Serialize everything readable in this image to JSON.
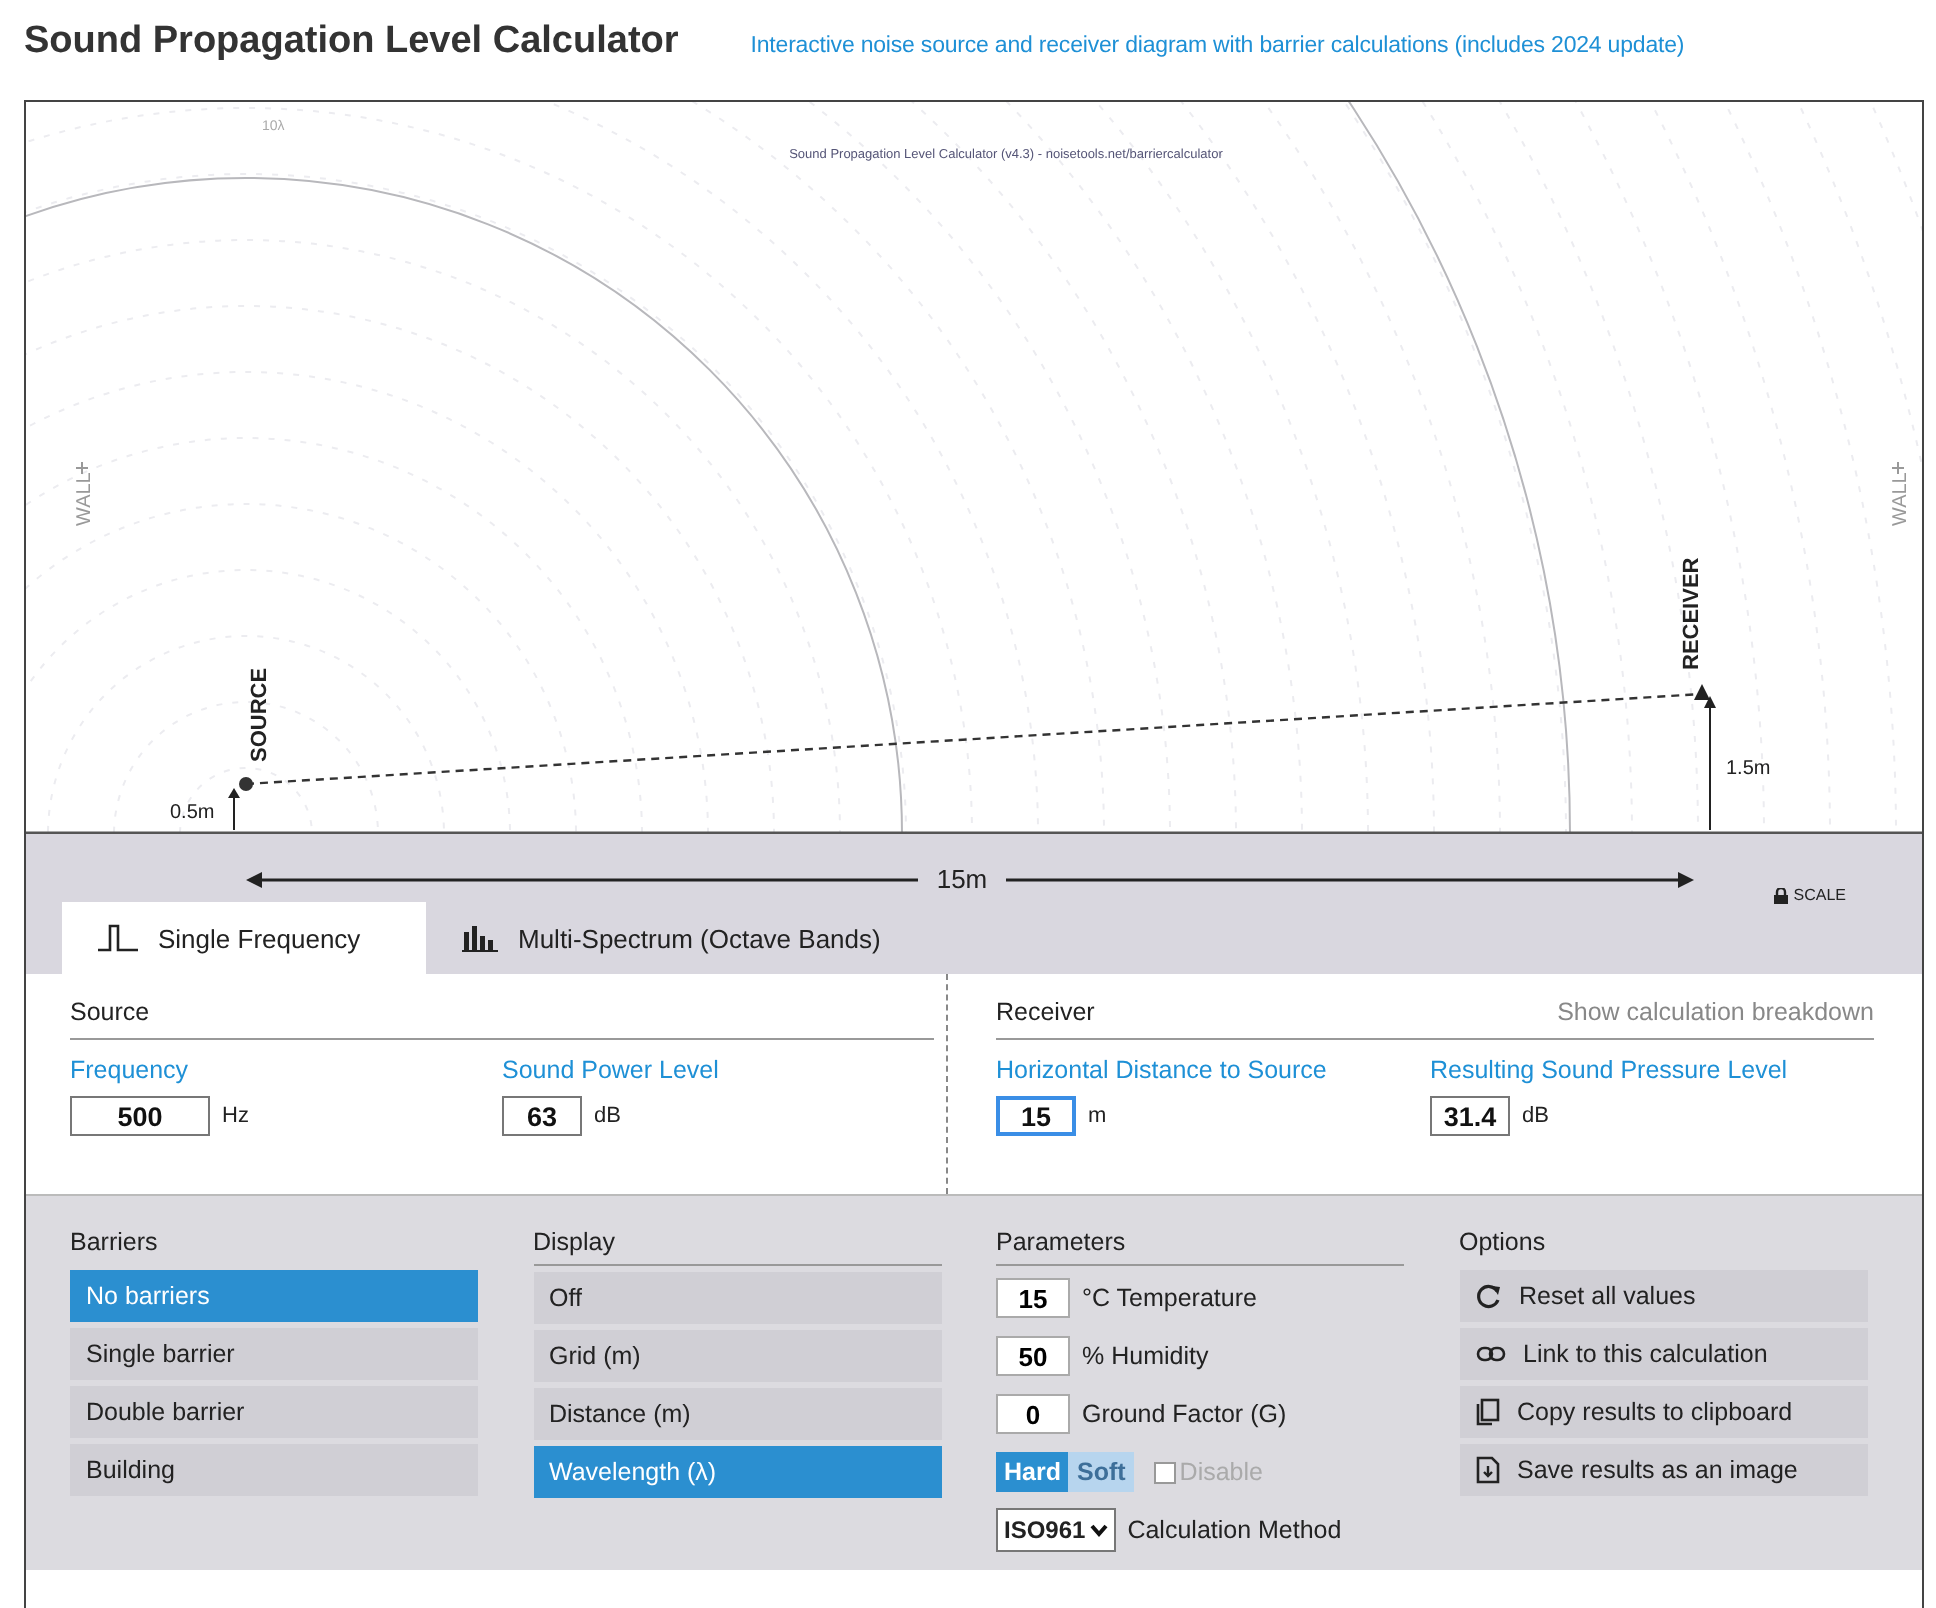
{
  "header": {
    "title": "Sound Propagation Level Calculator",
    "subtitle": "Interactive noise source and receiver diagram with barrier calculations (includes 2024 update)"
  },
  "diagram": {
    "caption": "Sound Propagation Level Calculator (v4.3) - noisetools.net/barriercalculator",
    "arc_label": "10λ",
    "wall_left": "WALL",
    "wall_right": "WALL",
    "source_label": "SOURCE",
    "source_height": "0.5m",
    "receiver_label": "RECEIVER",
    "receiver_height": "1.5m",
    "distance": "15m",
    "scale": "SCALE"
  },
  "tabs": [
    {
      "label": "Single Frequency",
      "kind": "pulse",
      "selected": true
    },
    {
      "label": "Multi-Spectrum (Octave Bands)",
      "kind": "bars",
      "selected": false
    }
  ],
  "source": {
    "heading": "Source",
    "fields": [
      {
        "label": "Frequency",
        "value": "500",
        "unit": "Hz",
        "focused": false
      },
      {
        "label": "Sound Power Level",
        "value": "63",
        "unit": "dB",
        "focused": false
      }
    ]
  },
  "receiver": {
    "heading": "Receiver",
    "breakdown_link": "Show calculation breakdown",
    "fields": [
      {
        "label": "Horizontal Distance to Source",
        "value": "15",
        "unit": "m",
        "focused": true
      },
      {
        "label": "Resulting Sound Pressure Level",
        "value": "31.4",
        "unit": "dB",
        "focused": false
      }
    ]
  },
  "barriers": {
    "heading": "Barriers",
    "items": [
      {
        "label": "No barriers",
        "selected": true
      },
      {
        "label": "Single barrier",
        "selected": false
      },
      {
        "label": "Double barrier",
        "selected": false
      },
      {
        "label": "Building",
        "selected": false
      }
    ]
  },
  "display": {
    "heading": "Display",
    "items": [
      {
        "label": "Off",
        "selected": false
      },
      {
        "label": "Grid (m)",
        "selected": false
      },
      {
        "label": "Distance (m)",
        "selected": false
      },
      {
        "label": "Wavelength (λ)",
        "selected": true
      }
    ]
  },
  "parameters": {
    "heading": "Parameters",
    "fields": [
      {
        "value": "15",
        "label": "°C Temperature"
      },
      {
        "value": "50",
        "label": "% Humidity"
      },
      {
        "value": "0",
        "label": "Ground Factor (G)"
      }
    ],
    "ground_buttons": [
      {
        "label": "Hard",
        "selected": true
      },
      {
        "label": "Soft",
        "selected": false
      }
    ],
    "disable": {
      "label": "Disable",
      "checked": false
    },
    "method": {
      "value": "ISO961",
      "label": "Calculation Method"
    }
  },
  "options": {
    "heading": "Options",
    "items": [
      {
        "label": "Reset all values",
        "kind": "reset"
      },
      {
        "label": "Link to this calculation",
        "kind": "link"
      },
      {
        "label": "Copy results to clipboard",
        "kind": "copy"
      },
      {
        "label": "Save results as an image",
        "kind": "save"
      }
    ]
  }
}
